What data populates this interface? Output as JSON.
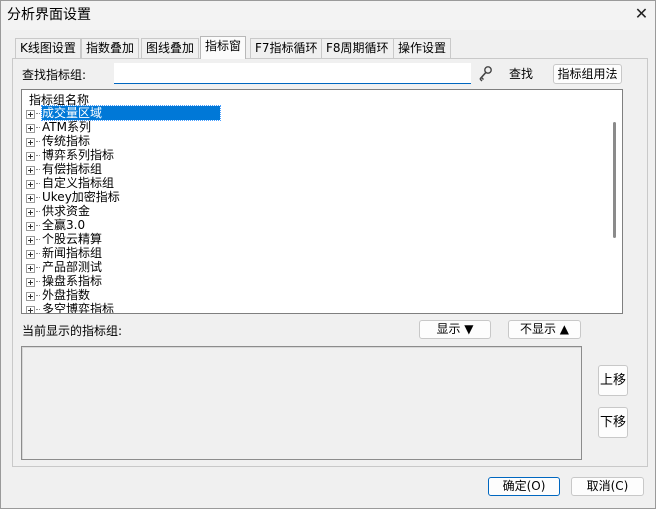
{
  "window": {
    "title": "分析界面设置",
    "close_glyph": "✕"
  },
  "tabs": [
    {
      "label": "K线图设置"
    },
    {
      "label": "指数叠加"
    },
    {
      "label": "图线叠加"
    },
    {
      "label": "指标窗",
      "active": true
    },
    {
      "label": "F7指标循环"
    },
    {
      "label": "F8周期循环"
    },
    {
      "label": "操作设置"
    }
  ],
  "search": {
    "label": "查找指标组:",
    "value": "",
    "key_icon": "key-icon",
    "find_button": "查找",
    "usage_button": "指标组用法"
  },
  "tree": {
    "header": "指标组名称",
    "items": [
      "成交量区域",
      "ATM系列",
      "传统指标",
      "博弈系列指标",
      "有偿指标组",
      "自定义指标组",
      "Ukey加密指标",
      "供求资金",
      "全赢3.0",
      "个股云精算",
      "新闻指标组",
      "产品部测试",
      "操盘系指标",
      "外盘指数",
      "多空博弈指标"
    ],
    "selected_index": 0
  },
  "current": {
    "label": "当前显示的指标组:",
    "show_button": "显示 ▼",
    "hide_button": "不显示 ▲",
    "up_button": "上移",
    "down_button": "下移",
    "items": []
  },
  "footer": {
    "ok_button": "确定(O)",
    "cancel_button": "取消(C)"
  },
  "colors": {
    "accent": "#0067c0",
    "selection": "#0078d7"
  }
}
